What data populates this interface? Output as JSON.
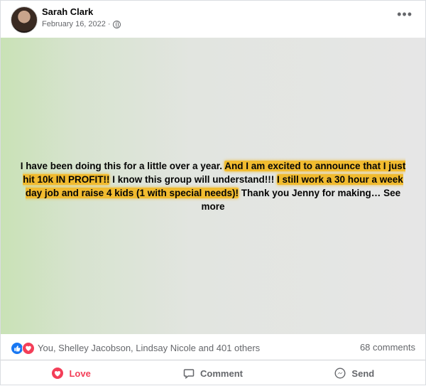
{
  "post": {
    "author": "Sarah Clark",
    "date": "February 16, 2022",
    "date_sep": "·",
    "more_icon": "more-horizontal-icon",
    "text_plain_1": "I have been doing this for a little over a year. ",
    "text_hl_1": "And I am excited to announce that I just hit 10k IN PROFIT!!",
    "text_plain_2": " I know this group will understand!!! ",
    "text_hl_2": "I still work a 30 hour a week day job and raise 4 kids (1 with special needs)!",
    "text_plain_3": " Thank you Jenny for making… ",
    "see_more": "See more",
    "highlight_color": "#f1bb2f"
  },
  "reactions": {
    "icons": [
      "like-icon",
      "love-icon"
    ],
    "names": "You, Shelley Jacobson, Lindsay Nicole and 401 others",
    "comments": "68 comments"
  },
  "actions": {
    "love": "Love",
    "comment": "Comment",
    "send": "Send"
  }
}
